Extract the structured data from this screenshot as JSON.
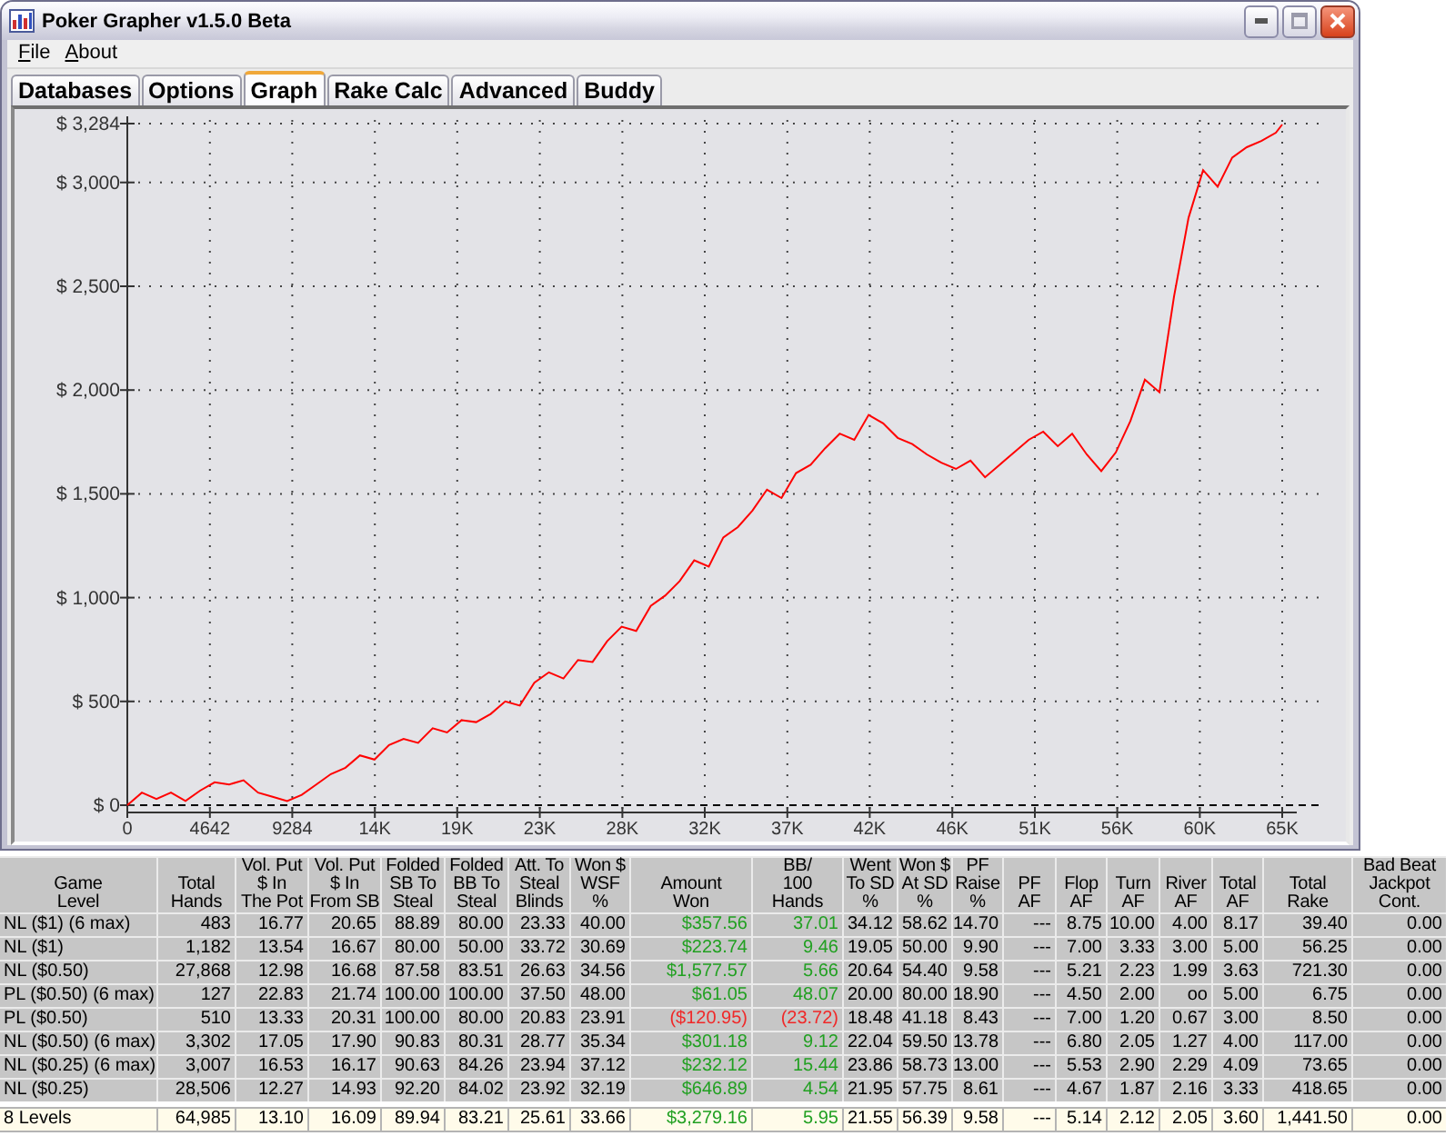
{
  "window": {
    "title": "Poker Grapher v1.5.0 Beta"
  },
  "menu": [
    "File",
    "About"
  ],
  "tabs": [
    {
      "label": "Databases",
      "selected": false
    },
    {
      "label": "Options",
      "selected": false
    },
    {
      "label": "Graph",
      "selected": true
    },
    {
      "label": "Rake Calc",
      "selected": false
    },
    {
      "label": "Advanced",
      "selected": false
    },
    {
      "label": "Buddy",
      "selected": false
    }
  ],
  "graph": {
    "chart_data": {
      "type": "line",
      "grid": true,
      "x": [
        0,
        818,
        1636,
        2454,
        3272,
        4090,
        4908,
        5726,
        6544,
        7362,
        8180,
        8998,
        9816,
        10634,
        11452,
        12270,
        13088,
        13906,
        14724,
        15542,
        16360,
        17178,
        17996,
        18814,
        19632,
        20450,
        21268,
        22086,
        22904,
        23722,
        24540,
        25358,
        26176,
        26994,
        27812,
        28630,
        29448,
        30266,
        31084,
        31902,
        32720,
        33538,
        34356,
        35174,
        35992,
        36810,
        37628,
        38446,
        39264,
        40082,
        40900,
        41718,
        42536,
        43354,
        44172,
        44990,
        45808,
        46626,
        47444,
        48262,
        49080,
        49898,
        50716,
        51534,
        52352,
        53170,
        53988,
        54806,
        55624,
        56442,
        57260,
        58078,
        58896,
        59714,
        60532,
        61350,
        62168,
        62986,
        63804,
        64622,
        64985
      ],
      "series": [
        {
          "color": "#ff0000",
          "values": [
            0,
            60,
            30,
            60,
            20,
            70,
            110,
            100,
            120,
            60,
            40,
            20,
            50,
            100,
            150,
            180,
            240,
            220,
            290,
            320,
            300,
            370,
            350,
            410,
            400,
            440,
            500,
            480,
            590,
            640,
            610,
            700,
            690,
            790,
            860,
            840,
            960,
            1010,
            1080,
            1180,
            1150,
            1290,
            1340,
            1420,
            1520,
            1480,
            1600,
            1640,
            1720,
            1790,
            1760,
            1880,
            1840,
            1770,
            1740,
            1690,
            1650,
            1620,
            1660,
            1580,
            1640,
            1700,
            1760,
            1800,
            1730,
            1790,
            1690,
            1610,
            1700,
            1850,
            2050,
            1990,
            2450,
            2830,
            3060,
            2980,
            3120,
            3170,
            3200,
            3240,
            3280
          ]
        }
      ],
      "xlim": [
        0,
        64985
      ],
      "ylim": [
        0,
        3284
      ],
      "xticks": [
        0,
        4642,
        9284,
        {
          "value": 13926,
          "label": "14K"
        },
        {
          "value": 18568,
          "label": "19K"
        },
        {
          "value": 23210,
          "label": "23K"
        },
        {
          "value": 27852,
          "label": "28K"
        },
        {
          "value": 32494,
          "label": "32K"
        },
        {
          "value": 37136,
          "label": "37K"
        },
        {
          "value": 41778,
          "label": "42K"
        },
        {
          "value": 46420,
          "label": "46K"
        },
        {
          "value": 51062,
          "label": "51K"
        },
        {
          "value": 55704,
          "label": "56K"
        },
        {
          "value": 60346,
          "label": "60K"
        },
        {
          "value": 64985,
          "label": "65K"
        }
      ],
      "yticks": [
        {
          "value": 0,
          "label": "$ 0"
        },
        {
          "value": 500,
          "label": "$ 500"
        },
        {
          "value": 1000,
          "label": "$ 1,000"
        },
        {
          "value": 1500,
          "label": "$ 1,500"
        },
        {
          "value": 2000,
          "label": "$ 2,000"
        },
        {
          "value": 2500,
          "label": "$ 2,500"
        },
        {
          "value": 3000,
          "label": "$ 3,000"
        },
        {
          "value": 3284,
          "label": "$ 3,284"
        }
      ]
    }
  },
  "table": {
    "columns": [
      {
        "label": "Game\nLevel",
        "kind": "text"
      },
      {
        "label": "Total\nHands",
        "kind": "number"
      },
      {
        "label": "Vol. Put\n$ In\nThe Pot",
        "kind": "number"
      },
      {
        "label": "Vol. Put\n$ In\nFrom SB",
        "kind": "number"
      },
      {
        "label": "Folded\nSB To\nSteal",
        "kind": "number"
      },
      {
        "label": "Folded\nBB To\nSteal",
        "kind": "number"
      },
      {
        "label": "Att. To\nSteal\nBlinds",
        "kind": "number"
      },
      {
        "label": "Won $\nWSF\n%",
        "kind": "number"
      },
      {
        "label": "Amount\nWon",
        "kind": "result"
      },
      {
        "label": "BB/\n100\nHands",
        "kind": "result"
      },
      {
        "label": "Went\nTo SD\n%",
        "kind": "number"
      },
      {
        "label": "Won $\nAt SD\n%",
        "kind": "number"
      },
      {
        "label": "PF\nRaise\n%",
        "kind": "number"
      },
      {
        "label": "PF\nAF",
        "kind": "number"
      },
      {
        "label": "Flop\nAF",
        "kind": "number"
      },
      {
        "label": "Turn\nAF",
        "kind": "number"
      },
      {
        "label": "River\nAF",
        "kind": "number"
      },
      {
        "label": "Total\nAF",
        "kind": "number"
      },
      {
        "label": "Total\nRake",
        "kind": "number"
      },
      {
        "label": "Bad Beat\nJackpot\nCont.",
        "kind": "number"
      }
    ],
    "rows": [
      {
        "negative": false,
        "cells": [
          "NL ($1) (6 max)",
          "483",
          "16.77",
          "20.65",
          "88.89",
          "80.00",
          "23.33",
          "40.00",
          "$357.56",
          "37.01",
          "34.12",
          "58.62",
          "14.70",
          "---",
          "8.75",
          "10.00",
          "4.00",
          "8.17",
          "39.40",
          "0.00"
        ]
      },
      {
        "negative": false,
        "cells": [
          "NL ($1)",
          "1,182",
          "13.54",
          "16.67",
          "80.00",
          "50.00",
          "33.72",
          "30.69",
          "$223.74",
          "9.46",
          "19.05",
          "50.00",
          "9.90",
          "---",
          "7.00",
          "3.33",
          "3.00",
          "5.00",
          "56.25",
          "0.00"
        ]
      },
      {
        "negative": false,
        "cells": [
          "NL ($0.50)",
          "27,868",
          "12.98",
          "16.68",
          "87.58",
          "83.51",
          "26.63",
          "34.56",
          "$1,577.57",
          "5.66",
          "20.64",
          "54.40",
          "9.58",
          "---",
          "5.21",
          "2.23",
          "1.99",
          "3.63",
          "721.30",
          "0.00"
        ]
      },
      {
        "negative": false,
        "cells": [
          "PL ($0.50) (6 max)",
          "127",
          "22.83",
          "21.74",
          "100.00",
          "100.00",
          "37.50",
          "48.00",
          "$61.05",
          "48.07",
          "20.00",
          "80.00",
          "18.90",
          "---",
          "4.50",
          "2.00",
          "oo",
          "5.00",
          "6.75",
          "0.00"
        ]
      },
      {
        "negative": true,
        "cells": [
          "PL ($0.50)",
          "510",
          "13.33",
          "20.31",
          "100.00",
          "80.00",
          "20.83",
          "23.91",
          "($120.95)",
          "(23.72)",
          "18.48",
          "41.18",
          "8.43",
          "---",
          "7.00",
          "1.20",
          "0.67",
          "3.00",
          "8.50",
          "0.00"
        ]
      },
      {
        "negative": false,
        "cells": [
          "NL ($0.50) (6 max)",
          "3,302",
          "17.05",
          "17.90",
          "90.83",
          "80.31",
          "28.77",
          "35.34",
          "$301.18",
          "9.12",
          "22.04",
          "59.50",
          "13.78",
          "---",
          "6.80",
          "2.05",
          "1.27",
          "4.00",
          "117.00",
          "0.00"
        ]
      },
      {
        "negative": false,
        "cells": [
          "NL ($0.25) (6 max)",
          "3,007",
          "16.53",
          "16.17",
          "90.63",
          "84.26",
          "23.94",
          "37.12",
          "$232.12",
          "15.44",
          "23.86",
          "58.73",
          "13.00",
          "---",
          "5.53",
          "2.90",
          "2.29",
          "4.09",
          "73.65",
          "0.00"
        ]
      },
      {
        "negative": false,
        "cells": [
          "NL ($0.25)",
          "28,506",
          "12.27",
          "14.93",
          "92.20",
          "84.02",
          "23.92",
          "32.19",
          "$646.89",
          "4.54",
          "21.95",
          "57.75",
          "8.61",
          "---",
          "4.67",
          "1.87",
          "2.16",
          "3.33",
          "418.65",
          "0.00"
        ]
      }
    ],
    "totals": {
      "negative": false,
      "cells": [
        "8 Levels",
        "64,985",
        "13.10",
        "16.09",
        "89.94",
        "83.21",
        "25.61",
        "33.66",
        "$3,279.16",
        "5.95",
        "21.55",
        "56.39",
        "9.58",
        "---",
        "5.14",
        "2.12",
        "2.05",
        "3.60",
        "1,441.50",
        "0.00"
      ]
    }
  }
}
